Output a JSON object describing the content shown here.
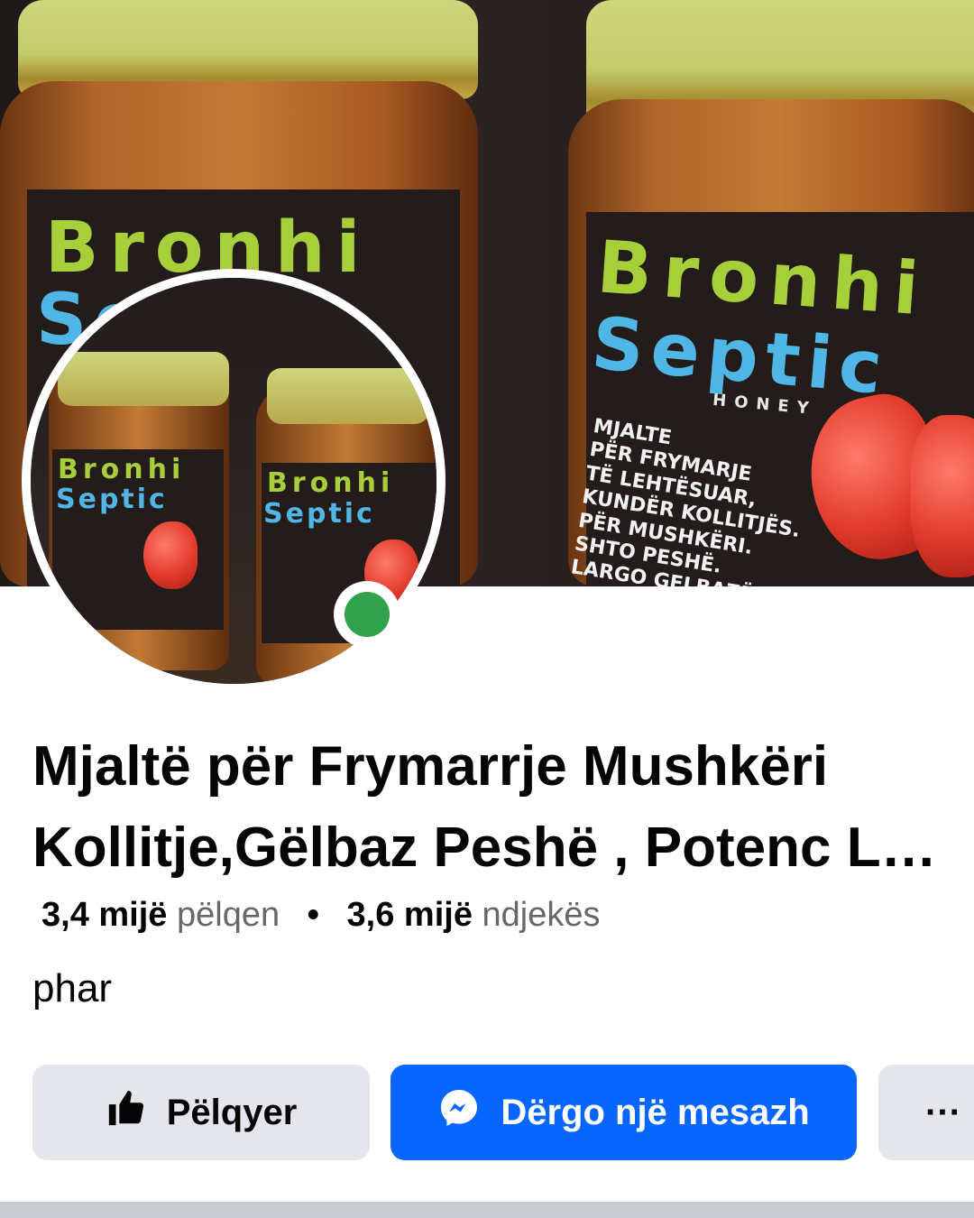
{
  "page": {
    "title": "Mjaltë për Frymarrje Mushkëri Kollitje,Gëlbaz Peshë , Potenc L…",
    "title_line1": "Mjaltë për Frymarrje Mushkëri",
    "title_line2": "Kollitje,Gëlbaz Peshë , Potenc L…",
    "likes_count": "3,4 mijë",
    "likes_label": "pëlqen",
    "followers_count": "3,6 mijë",
    "followers_label": "ndjekës",
    "separator": "•",
    "category": "phar",
    "online": true
  },
  "product_label": {
    "brand_line1": "Bronhi",
    "brand_line2": "Septic",
    "brand_line3": "HONEY",
    "text_lines": [
      "MJALTE",
      "PËR FRYMARJE",
      "TË LEHTËSUAR,",
      "KUNDËR KOLLITJËS.",
      "PËR MUSHKËRI.",
      "SHTO PESHË.",
      "LARGO GELBAZËN."
    ]
  },
  "actions": {
    "like_label": "Pëlqyer",
    "message_label": "Dërgo një mesazh",
    "more_label": "···"
  },
  "icons": {
    "like": "thumbs-up-icon",
    "message": "messenger-icon",
    "online": "online-status-icon"
  },
  "colors": {
    "primary": "#0866ff",
    "secondary_button": "#e4e6eb",
    "online": "#31a24c",
    "text": "#050505",
    "muted": "#65676b"
  }
}
